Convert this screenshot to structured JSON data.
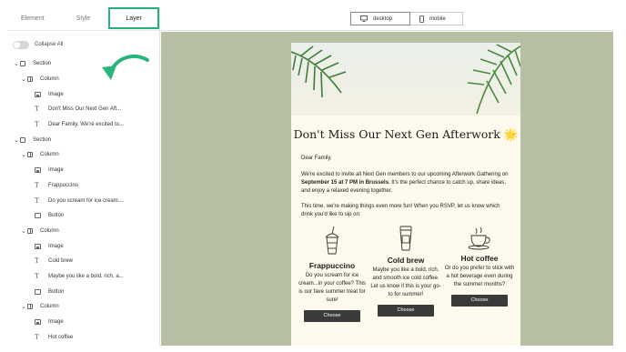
{
  "tabs": [
    {
      "label": "Element"
    },
    {
      "label": "Style"
    },
    {
      "label": "Layer"
    }
  ],
  "collapse_all_label": "Collapse All",
  "tree": [
    {
      "label": "Section"
    },
    {
      "label": "Column"
    },
    {
      "label": "Image"
    },
    {
      "label": "Don't Miss Our Next Gen Aft..."
    },
    {
      "label": "Dear Family, We're excited to..."
    },
    {
      "label": "Section"
    },
    {
      "label": "Column"
    },
    {
      "label": "Image"
    },
    {
      "label": "Frappuccino"
    },
    {
      "label": "Do you scream for ice cream...."
    },
    {
      "label": "Button"
    },
    {
      "label": "Column"
    },
    {
      "label": "Image"
    },
    {
      "label": "Cold brew"
    },
    {
      "label": "Maybe you like a bold, rich, a..."
    },
    {
      "label": "Button"
    },
    {
      "label": "Column"
    },
    {
      "label": "Image"
    },
    {
      "label": "Hot coffee"
    }
  ],
  "devices": {
    "desktop": "desktop",
    "mobile": "mobile"
  },
  "email": {
    "headline": "Don't Miss Our Next Gen Afterwork",
    "headline_emoji": "🌟",
    "greeting": "Dear Family,",
    "p1_a": "We're excited to invite all Next Gen members to our upcoming Afterwork Gathering on ",
    "p1_bold": "September 15 at 7 PM in Brussels",
    "p1_b": ". It's the perfect chance to catch up, share ideas, and enjoy a relaxed evening together.",
    "p2": "This time, we're making things even more fun! When you RSVP, let us know which drink you'd like to sip on:",
    "drinks": [
      {
        "title": "Frappuccino",
        "desc": "Do you scream for ice cream...in your coffee? This is our fave summer treat for sure!",
        "button": "Choose",
        "icon": "frappuccino-icon"
      },
      {
        "title": "Cold brew",
        "desc": "Maybe you like a bold, rich, and smooth ice cold coffee. Let us know if this is your go-to for summer!",
        "button": "Choose",
        "icon": "cold-brew-icon"
      },
      {
        "title": "Hot coffee",
        "desc": "Or do you prefer to stick with a hot beverage even during the summer months?",
        "button": "Choose",
        "icon": "hot-coffee-icon"
      }
    ]
  },
  "colors": {
    "accent": "#25b27a",
    "canvas": "#b6bfa4",
    "email_bg": "#fdf9ec",
    "button": "#3a3a3a"
  }
}
